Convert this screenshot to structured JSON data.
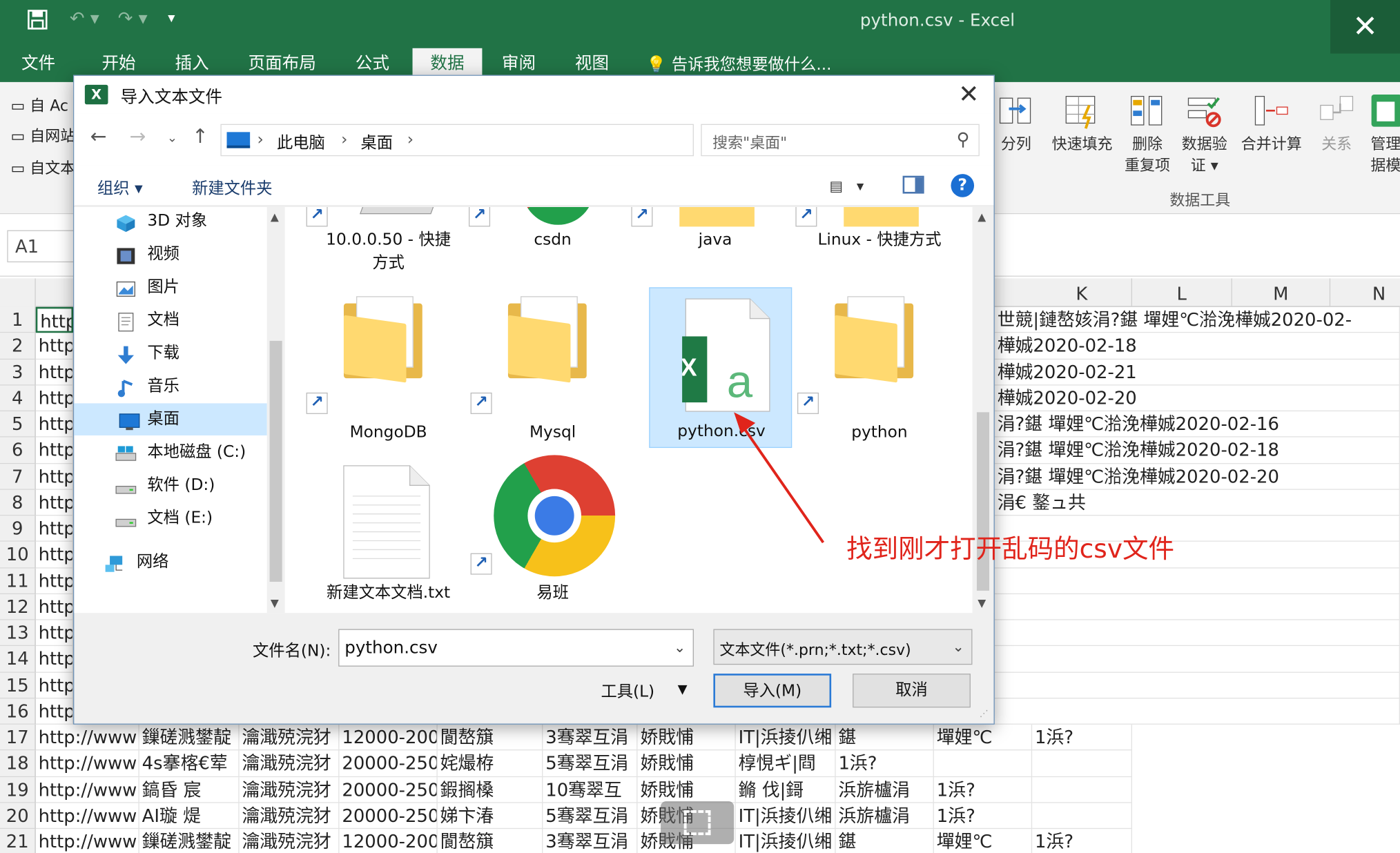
{
  "window": {
    "title": "python.csv - Excel"
  },
  "ribbon_tabs": [
    "文件",
    "开始",
    "插入",
    "页面布局",
    "公式",
    "数据",
    "审阅",
    "视图"
  ],
  "active_tab": "数据",
  "tell_me": "告诉我您想要做什么...",
  "ribbon": {
    "left_items": [
      "自 Ac",
      "自网站",
      "自文本"
    ],
    "buttons": [
      {
        "label": "分列",
        "icon": "text-to-columns-icon"
      },
      {
        "label": "快速填充",
        "icon": "flash-fill-icon"
      },
      {
        "label": "删除\n重复项",
        "icon": "remove-duplicates-icon"
      },
      {
        "label": "数据验\n证 ▾",
        "icon": "data-validation-icon"
      },
      {
        "label": "合并计算",
        "icon": "consolidate-icon"
      },
      {
        "label": "关系",
        "icon": "relationships-icon"
      },
      {
        "label": "管理\n据模",
        "icon": "data-model-icon"
      }
    ],
    "group_label": "数据工具"
  },
  "name_box": "A1",
  "columns": [
    "K",
    "L",
    "M",
    "N"
  ],
  "rows": [
    {
      "n": "1",
      "a": "http",
      "right": "世競|鏈嶅姟涓?鍖   墠娌℃湁浼樺娍2020-02-"
    },
    {
      "n": "2",
      "a": "http",
      "right": "樺娍2020-02-18"
    },
    {
      "n": "3",
      "a": "http",
      "right": "樺娍2020-02-21"
    },
    {
      "n": "4",
      "a": "http",
      "right": "樺娍2020-02-20"
    },
    {
      "n": "5",
      "a": "http",
      "right": "涓?鍖   墠娌℃湁浼樺娍2020-02-16"
    },
    {
      "n": "6",
      "a": "http",
      "right": "涓?鍖   墠娌℃湁浼樺娍2020-02-18"
    },
    {
      "n": "7",
      "a": "http",
      "right": "涓?鍖   墠娌℃湁浼樺娍2020-02-20"
    },
    {
      "n": "8",
      "a": "http",
      "right": "涓€ 鐜ュ共"
    },
    {
      "n": "9",
      "a": "http",
      "right": ""
    },
    {
      "n": "10",
      "a": "http",
      "right": ""
    },
    {
      "n": "11",
      "a": "http",
      "right": ""
    },
    {
      "n": "12",
      "a": "http",
      "right": ""
    },
    {
      "n": "13",
      "a": "http",
      "right": ""
    },
    {
      "n": "14",
      "a": "http",
      "right": ""
    },
    {
      "n": "15",
      "a": "http",
      "right": ""
    },
    {
      "n": "16",
      "a": "http",
      "right": ""
    }
  ],
  "full_rows": [
    {
      "n": "17",
      "c": [
        "http://www",
        "鏁磋溅鐢靛",
        "瀹濈殑浣犲",
        "12000-200",
        "閬嶅簱",
        "3骞翠互涓",
        "娇戝悑",
        "IT|浜掕仈缃",
        "鍖",
        "墠娌℃",
        "1浜?"
      ]
    },
    {
      "n": "18",
      "c": [
        "http://www",
        "4s搴楁€荤",
        "瀹濈殑浣犲",
        "20000-250",
        "姹熶栫",
        "5骞翠互涓",
        "娇戝悑",
        "椁悓ギ|閰",
        "1浜?",
        "",
        ""
      ]
    },
    {
      "n": "19",
      "c": [
        "http://www",
        "鎬昏 宸",
        "瀹濈殑浣犲",
        "20000-250",
        "鍜搁槡",
        "10骞翠互",
        "娇戝悑",
        "鏅 伐|鎶",
        "浜旂櫨涓",
        "1浜?",
        ""
      ]
    },
    {
      "n": "20",
      "c": [
        "http://www",
        "AI璇 煶",
        "瀹濈殑浣犲",
        "20000-250",
        "娣卞湷",
        "5骞翠互涓",
        "娇戝悑",
        "IT|浜掕仈缃",
        "浜旂櫨涓",
        "1浜?",
        ""
      ]
    },
    {
      "n": "21",
      "c": [
        "http://www",
        "鏁磋溅鐢靛",
        "瀹濈殑浣犲",
        "12000-200",
        "閬嶅簱",
        "3骞翠互涓",
        "娇戝悑",
        "IT|浜掕仈缃",
        "鍖",
        "墠娌℃",
        "1浜?"
      ]
    }
  ],
  "dialog": {
    "title": "导入文本文件",
    "breadcrumb": [
      "此电脑",
      "桌面"
    ],
    "search_placeholder": "搜索\"桌面\"",
    "organize": "组织 ▾",
    "new_folder": "新建文件夹",
    "nav_items": [
      {
        "label": "3D 对象",
        "icon": "3d-objects-icon"
      },
      {
        "label": "视频",
        "icon": "video-icon"
      },
      {
        "label": "图片",
        "icon": "pictures-icon"
      },
      {
        "label": "文档",
        "icon": "documents-icon"
      },
      {
        "label": "下载",
        "icon": "download-icon"
      },
      {
        "label": "音乐",
        "icon": "music-icon"
      },
      {
        "label": "桌面",
        "icon": "desktop-icon",
        "selected": true
      },
      {
        "label": "本地磁盘 (C:)",
        "icon": "local-disk-icon"
      },
      {
        "label": "软件 (D:)",
        "icon": "drive-icon"
      },
      {
        "label": "文档 (E:)",
        "icon": "drive-icon"
      },
      {
        "label": "网络",
        "icon": "network-icon"
      }
    ],
    "files_row1": [
      "10.0.0.50 - 快捷\n方式",
      "csdn",
      "java",
      "Linux - 快捷方式"
    ],
    "files_row2": [
      {
        "label": "MongoDB",
        "kind": "folder"
      },
      {
        "label": "Mysql",
        "kind": "folder"
      },
      {
        "label": "python.csv",
        "kind": "excel",
        "selected": true
      },
      {
        "label": "python",
        "kind": "folder"
      }
    ],
    "files_row3": [
      {
        "label": "新建文本文档.txt",
        "kind": "text"
      },
      {
        "label": "易班",
        "kind": "chrome"
      }
    ],
    "filename_label": "文件名(N):",
    "filename_value": "python.csv",
    "filetype": "文本文件(*.prn;*.txt;*.csv)",
    "tools": "工具(L)",
    "open_button": "导入(M)",
    "cancel_button": "取消"
  },
  "annotation": {
    "text": "找到刚才打开乱码的csv文件",
    "color": "#e0241b"
  }
}
